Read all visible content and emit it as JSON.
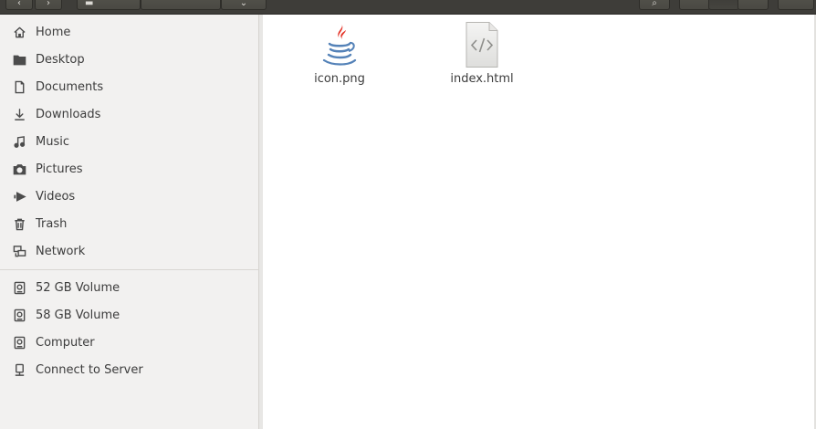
{
  "sidebar": {
    "places": [
      {
        "label": "Home",
        "icon": "home-icon"
      },
      {
        "label": "Desktop",
        "icon": "desktop-icon"
      },
      {
        "label": "Documents",
        "icon": "documents-icon"
      },
      {
        "label": "Downloads",
        "icon": "downloads-icon"
      },
      {
        "label": "Music",
        "icon": "music-icon"
      },
      {
        "label": "Pictures",
        "icon": "pictures-icon"
      },
      {
        "label": "Videos",
        "icon": "videos-icon"
      },
      {
        "label": "Trash",
        "icon": "trash-icon"
      },
      {
        "label": "Network",
        "icon": "network-icon"
      }
    ],
    "devices": [
      {
        "label": "52 GB Volume",
        "icon": "drive-icon"
      },
      {
        "label": "58 GB Volume",
        "icon": "drive-icon"
      },
      {
        "label": "Computer",
        "icon": "drive-icon"
      },
      {
        "label": "Connect to Server",
        "icon": "server-icon"
      }
    ]
  },
  "files": [
    {
      "name": "icon.png",
      "icon": "java-icon"
    },
    {
      "name": "index.html",
      "icon": "html-file-icon"
    }
  ],
  "colors": {
    "toolbar": "#3e3d39",
    "sidebar_bg": "#f2f1f0",
    "java_red": "#e43226",
    "java_blue": "#5482b8"
  }
}
